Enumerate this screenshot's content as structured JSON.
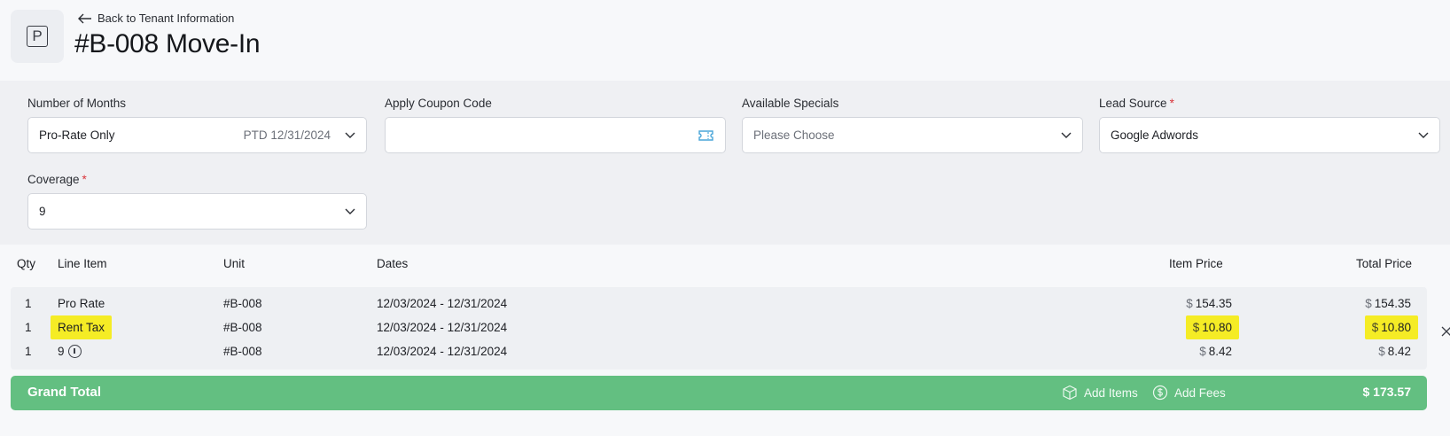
{
  "header": {
    "logo_letter": "P",
    "back_label": "Back to Tenant Information",
    "title": "#B-008 Move-In"
  },
  "form": {
    "months": {
      "label": "Number of Months",
      "value": "Pro-Rate Only",
      "ptd": "PTD 12/31/2024"
    },
    "coupon": {
      "label": "Apply Coupon Code",
      "value": ""
    },
    "specials": {
      "label": "Available Specials",
      "placeholder": "Please Choose"
    },
    "lead_source": {
      "label": "Lead Source",
      "required_mark": "*",
      "value": "Google Adwords"
    },
    "coverage": {
      "label": "Coverage",
      "required_mark": "*",
      "value": "9"
    }
  },
  "table": {
    "headers": {
      "qty": "Qty",
      "line_item": "Line Item",
      "unit": "Unit",
      "dates": "Dates",
      "item_price": "Item Price",
      "total_price": "Total Price"
    },
    "currency": "$",
    "rows": [
      {
        "qty": "1",
        "line_item": "Pro Rate",
        "unit": "#B-008",
        "dates": "12/03/2024 - 12/31/2024",
        "item_price": "154.35",
        "total_price": "154.35"
      },
      {
        "qty": "1",
        "line_item": "Rent Tax",
        "unit": "#B-008",
        "dates": "12/03/2024 - 12/31/2024",
        "item_price": "10.80",
        "total_price": "10.80"
      },
      {
        "qty": "1",
        "line_item": "9",
        "unit": "#B-008",
        "dates": "12/03/2024 - 12/31/2024",
        "item_price": "8.42",
        "total_price": "8.42"
      }
    ]
  },
  "footer": {
    "grand_total_label": "Grand Total",
    "add_items_label": "Add Items",
    "add_fees_label": "Add Fees",
    "grand_total_value": "$ 173.57"
  },
  "colors": {
    "grand_total_bar": "#63bf81",
    "highlight": "#f5ec25",
    "required": "#d9343a"
  }
}
